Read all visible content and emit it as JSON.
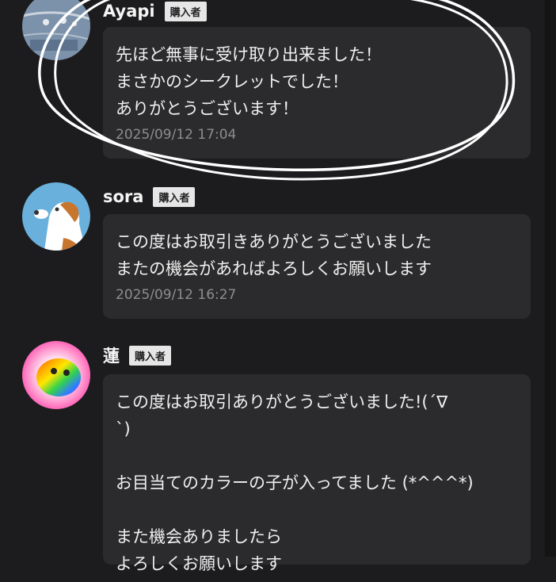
{
  "reviews": [
    {
      "name": "Ayapi",
      "badge": "購入者",
      "message": "先ほど無事に受け取り出来ました！\nまさかのシークレットでした！\nありがとうございます！",
      "timestamp": "2025/09/12 17:04",
      "avatar": "denim-avatar"
    },
    {
      "name": "sora",
      "badge": "購入者",
      "message": "この度はお取引きありがとうございました\nまたの機会があればよろしくお願いします",
      "timestamp": "2025/09/12 16:27",
      "avatar": "dog-avatar"
    },
    {
      "name": "蓮",
      "badge": "購入者",
      "message": "この度はお取引ありがとうございました!(´∇\n`)\n\nお目当てのカラーの子が入ってました (*^^^*)\n\nまた機会ありましたら\nよろしくお願いします",
      "avatar": "rainbow-avatar"
    }
  ],
  "colors": {
    "background": "#1c1c1e",
    "bubble": "#2b2b2d",
    "badge": "#e6e6e6",
    "timestamp": "#8d8d8f",
    "annotation": "#ffffff"
  }
}
